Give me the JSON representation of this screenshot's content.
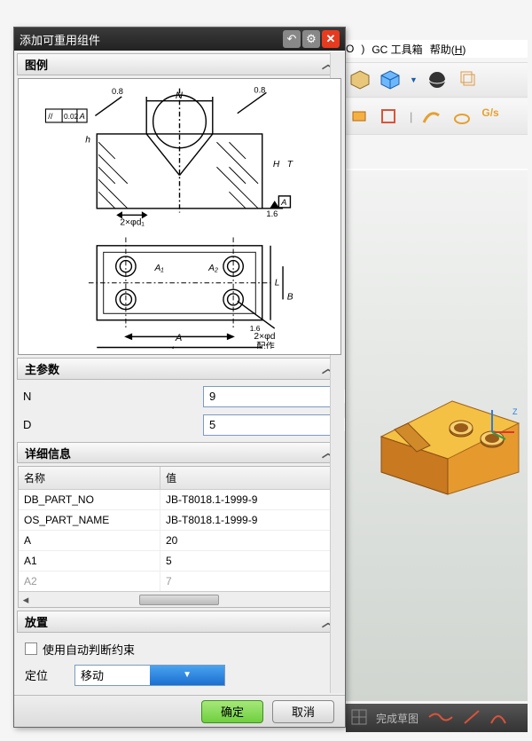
{
  "app": {
    "menu_gctoolbox": "GC 工具箱",
    "menu_help": "帮助",
    "menu_help_hotkey": "H",
    "menu_circle": "O",
    "status_finish_sketch": "完成草图"
  },
  "dialog": {
    "title": "添加可重用组件",
    "legend_label": "图例",
    "main_params_label": "主参数",
    "details_label": "详细信息",
    "placement_label": "放置",
    "use_auto_constraint": "使用自动判断约束",
    "positioning_label": "定位",
    "positioning_value": "移动",
    "ok": "确定",
    "cancel": "取消",
    "params": [
      {
        "name": "N",
        "value": "9"
      },
      {
        "name": "D",
        "value": "5"
      }
    ],
    "detail_cols": {
      "name": "名称",
      "value": "值"
    },
    "details": [
      {
        "name": "DB_PART_NO",
        "value": "JB-T8018.1-1999-9"
      },
      {
        "name": "OS_PART_NAME",
        "value": "JB-T8018.1-1999-9"
      },
      {
        "name": "A",
        "value": "20"
      },
      {
        "name": "A1",
        "value": "5"
      },
      {
        "name": "A2",
        "value": "7"
      }
    ],
    "drawing_labels": {
      "tol": "0.02",
      "datumA": "A",
      "note1": "2×φd₁",
      "note2": "2×φd",
      "fit": "配作"
    }
  }
}
